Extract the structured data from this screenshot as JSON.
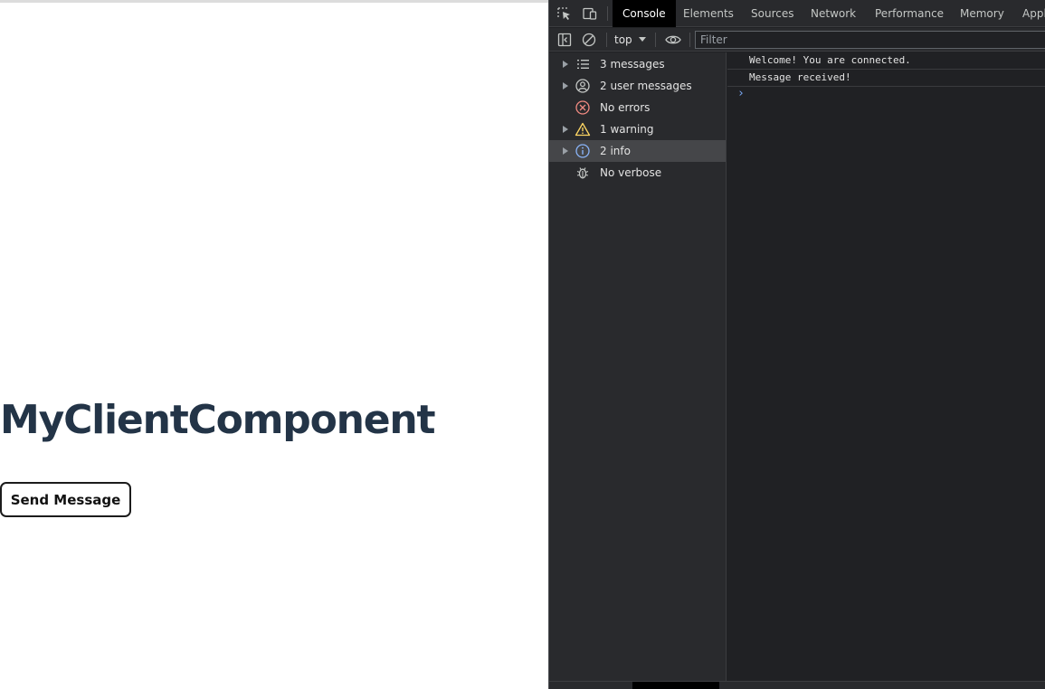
{
  "page": {
    "title": "MyClientComponent",
    "send_button_label": "Send Message"
  },
  "devtools": {
    "tabs": [
      {
        "label": "Console",
        "active": true
      },
      {
        "label": "Elements",
        "active": false
      },
      {
        "label": "Sources",
        "active": false
      },
      {
        "label": "Network",
        "active": false
      },
      {
        "label": "Performance",
        "active": false
      },
      {
        "label": "Memory",
        "active": false
      },
      {
        "label": "Appl",
        "active": false
      }
    ],
    "toolbar": {
      "context": "top",
      "filter_placeholder": "Filter"
    },
    "sidebar": [
      {
        "label": "3 messages",
        "icon": "list-icon",
        "expandable": true
      },
      {
        "label": "2 user messages",
        "icon": "user-circle-icon",
        "expandable": true
      },
      {
        "label": "No errors",
        "icon": "error-icon",
        "expandable": false
      },
      {
        "label": "1 warning",
        "icon": "warning-icon",
        "expandable": true
      },
      {
        "label": "2 info",
        "icon": "info-icon",
        "expandable": true,
        "selected": true
      },
      {
        "label": "No verbose",
        "icon": "bug-icon",
        "expandable": false
      }
    ],
    "console_lines": [
      "Welcome! You are connected.",
      "Message received!"
    ],
    "prompt": "›"
  },
  "colors": {
    "title": "#233447",
    "devtools_bg": "#202124",
    "panel_bg": "#292a2d",
    "error": "#f28b82",
    "warning": "#fdd663",
    "info": "#8ab4f8",
    "prompt": "#7cacf8"
  }
}
